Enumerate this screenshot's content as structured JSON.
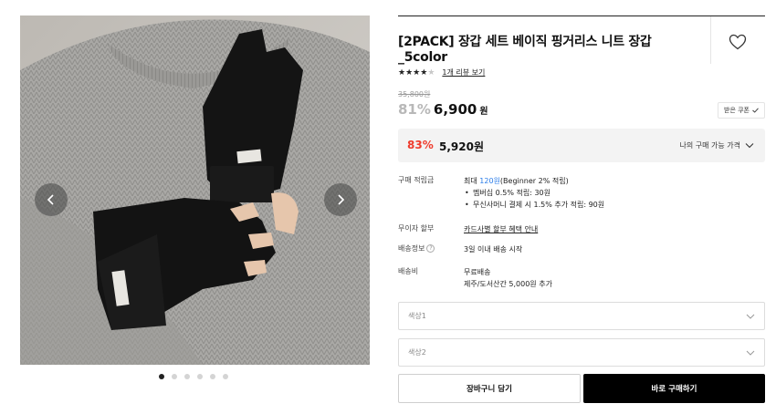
{
  "product": {
    "title": "[2PACK] 장갑 세트 베이직 핑거리스 니트 장갑_5color",
    "review_link": "1개 리뷰 보기",
    "rating": 4,
    "rating_max": 5,
    "original_price": "35,800원",
    "discount_rate": "81%",
    "price": "6,900",
    "price_unit": "원",
    "coupon_label": "받은 쿠폰"
  },
  "my_price": {
    "discount_rate": "83%",
    "amount": "5,920원",
    "label": "나의 구매 가능 가격"
  },
  "info": {
    "points_key": "구매 적립금",
    "points_prefix": "최대 ",
    "points_amount": "120원",
    "points_suffix": "(Beginner 2% 적립)",
    "points_detail_1": "멤버십 0.5% 적립: 30원",
    "points_detail_2": "무신사머니 결제 시 1.5% 추가 적립: 90원",
    "installment_key": "무이자 할부",
    "installment_value": "카드사별 할부 혜택 안내",
    "shipping_key": "배송정보",
    "shipping_value": "3일 이내 배송 시작",
    "fee_key": "배송비",
    "fee_value_1": "무료배송",
    "fee_value_2": "제주/도서산간 5,000원 추가"
  },
  "options": {
    "color1_placeholder": "색상1",
    "color2_placeholder": "색상2"
  },
  "actions": {
    "cart_label": "장바구니 담기",
    "buy_label": "바로 구매하기"
  },
  "gallery": {
    "total_images": 6,
    "current_index": 1
  },
  "colors": {
    "accent_red": "#ef3b2c",
    "link_blue": "#2b7de9",
    "buy_button": "#000000"
  }
}
